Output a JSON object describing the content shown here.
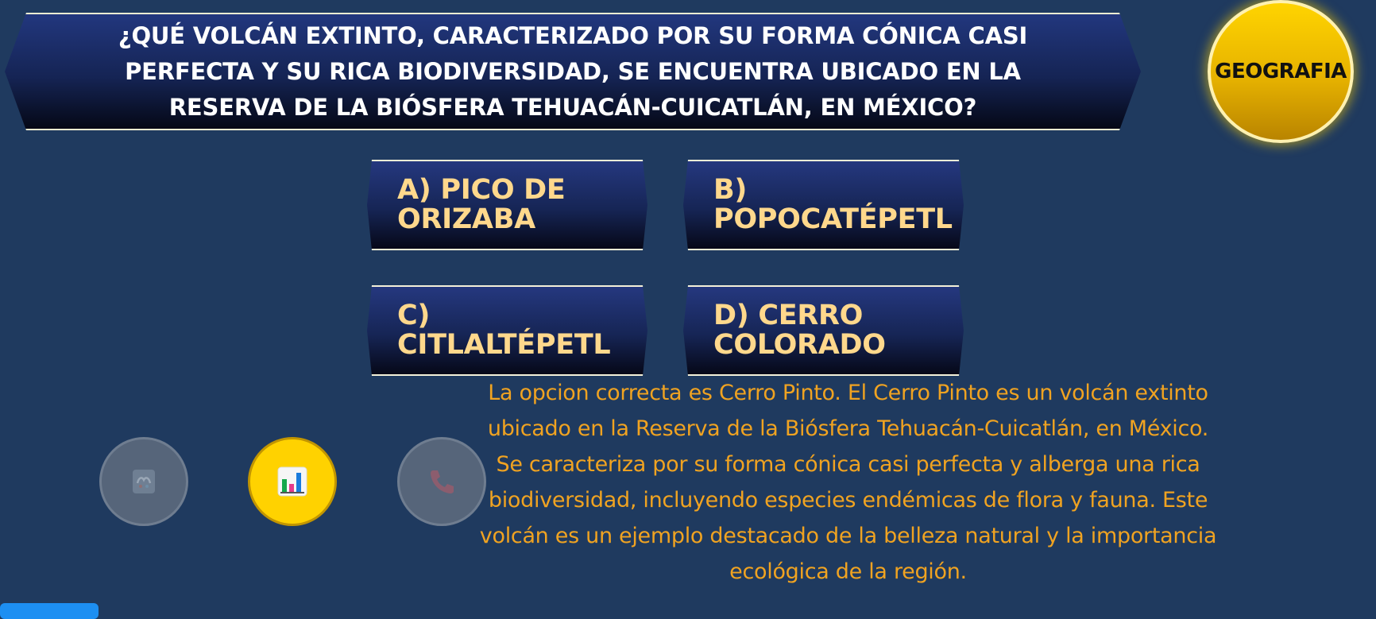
{
  "question": {
    "text": "¿QUÉ VOLCÁN EXTINTO, CARACTERIZADO POR SU FORMA CÓNICA CASI PERFECTA Y SU RICA BIODIVERSIDAD, SE ENCUENTRA UBICADO EN LA RESERVA DE LA BIÓSFERA TEHUACÁN-CUICATLÁN, EN MÉXICO?"
  },
  "category": {
    "label": "GEOGRAFIA",
    "color": "#f5c400"
  },
  "answers": [
    {
      "label": "A) PICO DE ORIZABA"
    },
    {
      "label": "B) POPOCATÉPETL"
    },
    {
      "label": "C) CITLALTÉPETL"
    },
    {
      "label": "D) CERRO COLORADO"
    }
  ],
  "explanation": {
    "text": "La opcion correcta es Cerro Pinto. El Cerro Pinto es un volcán extinto ubicado en la Reserva de la Biósfera Tehuacán-Cuicatlán, en México. Se caracteriza por su forma cónica casi perfecta y alberga una rica biodiversidad, incluyendo especies endémicas de flora y fauna. Este volcán es un ejemplo destacado de la belleza natural y la importancia ecológica de la región."
  },
  "lifelines": [
    {
      "icon": "card-fifty-fifty-icon",
      "state": "used"
    },
    {
      "icon": "audience-chart-icon",
      "state": "active"
    },
    {
      "icon": "phone-call-icon",
      "state": "used"
    }
  ],
  "colors": {
    "background": "#1f3a5f",
    "answer_text": "#ffd88c",
    "explanation_text": "#f0a321",
    "active_lifeline": "#ffd200"
  }
}
